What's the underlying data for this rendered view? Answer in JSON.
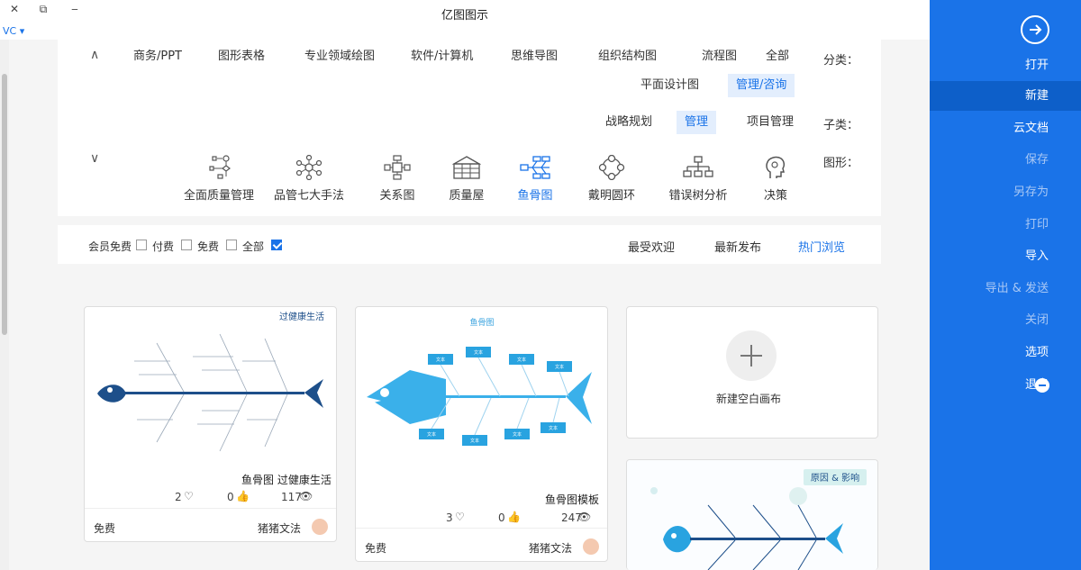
{
  "window": {
    "title": "亿图图示",
    "close_glyph": "✕",
    "restore_glyph": "⧉",
    "min_glyph": "‒",
    "address_fragment": "VC ▾"
  },
  "sidebar": {
    "back_glyph": "→",
    "items": [
      {
        "label": "打开"
      },
      {
        "label": "新建"
      },
      {
        "label": "云文档"
      },
      {
        "label": "保存"
      },
      {
        "label": "另存为"
      },
      {
        "label": "打印"
      },
      {
        "label": "导入"
      },
      {
        "label": "导出 & 发送"
      },
      {
        "label": "关闭"
      },
      {
        "label": "选项"
      },
      {
        "label": "退出"
      }
    ],
    "active_index": 1
  },
  "filters": {
    "category_label": "分类：",
    "categories": [
      "全部",
      "流程图",
      "组织结构图",
      "思维导图",
      "软件/计算机",
      "专业领域绘图",
      "图形表格",
      "商务/PPT",
      "管理/咨询",
      "平面设计图"
    ],
    "selected_category": "管理/咨询",
    "subcategory_label": "子类：",
    "subcategories": [
      "项目管理",
      "管理",
      "战略规划"
    ],
    "selected_subcategory": "管理",
    "shape_label": "图形：",
    "shapes": [
      "决策",
      "错误树分析",
      "戴明圆环",
      "鱼骨图",
      "质量屋",
      "关系图",
      "品管七大手法",
      "全面质量管理"
    ],
    "selected_shape": "鱼骨图"
  },
  "sort_tabs": [
    "热门浏览",
    "最新发布",
    "最受欢迎"
  ],
  "selected_sort": "热门浏览",
  "price_filter": [
    "全部",
    "免费",
    "付费",
    "会员免费"
  ],
  "price_checked": "全部",
  "new_blank_label": "新建空白画布",
  "templates": [
    {
      "title": "鱼骨图模板",
      "views": "247",
      "likes": "0",
      "favorites": "3",
      "author": "猪猪文法",
      "price": "免费"
    },
    {
      "title": "鱼骨图 过健康生活",
      "views": "117",
      "likes": "0",
      "favorites": "2",
      "author": "猪猪文法",
      "price": "免费",
      "thumb_heading": "过健康生活"
    }
  ],
  "thumb_texts": {
    "fish_title": "鱼骨图",
    "box": "文本",
    "hp_title": "原因 & 影响"
  },
  "colors": {
    "accent": "#1a73e8",
    "sidebar": "#1a73e8",
    "fish_blue": "#29a3e0",
    "fish_navy": "#1d4f8a"
  }
}
